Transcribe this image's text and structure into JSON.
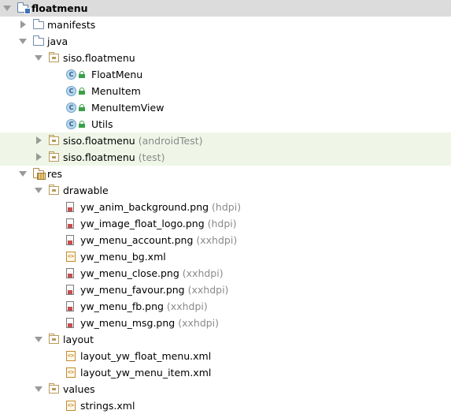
{
  "tree": [
    {
      "id": "floatmenu",
      "label": "floatmenu",
      "hint": "",
      "depth": 0,
      "expanded": true,
      "icon": "module-folder-icon",
      "bold": true,
      "state": "selected"
    },
    {
      "id": "manifests",
      "label": "manifests",
      "hint": "",
      "depth": 1,
      "expanded": false,
      "icon": "folder-icon"
    },
    {
      "id": "java",
      "label": "java",
      "hint": "",
      "depth": 1,
      "expanded": true,
      "icon": "folder-icon"
    },
    {
      "id": "pkg-main",
      "label": "siso.floatmenu",
      "hint": "",
      "depth": 2,
      "expanded": true,
      "icon": "package-icon"
    },
    {
      "id": "FloatMenu",
      "label": "FloatMenu",
      "hint": "",
      "depth": 3,
      "icon": "class-icon"
    },
    {
      "id": "MenuItem",
      "label": "MenuItem",
      "hint": "",
      "depth": 3,
      "icon": "class-icon"
    },
    {
      "id": "MenuItemView",
      "label": "MenuItemView",
      "hint": "",
      "depth": 3,
      "icon": "class-icon"
    },
    {
      "id": "Utils",
      "label": "Utils",
      "hint": "",
      "depth": 3,
      "icon": "class-icon"
    },
    {
      "id": "pkg-androidTest",
      "label": "siso.floatmenu",
      "hint": "(androidTest)",
      "depth": 2,
      "expanded": false,
      "icon": "package-icon",
      "state": "tested"
    },
    {
      "id": "pkg-test",
      "label": "siso.floatmenu",
      "hint": "(test)",
      "depth": 2,
      "expanded": false,
      "icon": "package-icon",
      "state": "tested"
    },
    {
      "id": "res",
      "label": "res",
      "hint": "",
      "depth": 1,
      "expanded": true,
      "icon": "res-folder-icon"
    },
    {
      "id": "drawable",
      "label": "drawable",
      "hint": "",
      "depth": 2,
      "expanded": true,
      "icon": "package-icon"
    },
    {
      "id": "d1",
      "label": "yw_anim_background.png",
      "hint": "(hdpi)",
      "depth": 3,
      "icon": "png-file-icon"
    },
    {
      "id": "d2",
      "label": "yw_image_float_logo.png",
      "hint": "(hdpi)",
      "depth": 3,
      "icon": "png-file-icon"
    },
    {
      "id": "d3",
      "label": "yw_menu_account.png",
      "hint": "(xxhdpi)",
      "depth": 3,
      "icon": "png-file-icon"
    },
    {
      "id": "d4",
      "label": "yw_menu_bg.xml",
      "hint": "",
      "depth": 3,
      "icon": "xml-file-icon"
    },
    {
      "id": "d5",
      "label": "yw_menu_close.png",
      "hint": "(xxhdpi)",
      "depth": 3,
      "icon": "png-file-icon"
    },
    {
      "id": "d6",
      "label": "yw_menu_favour.png",
      "hint": "(xxhdpi)",
      "depth": 3,
      "icon": "png-file-icon"
    },
    {
      "id": "d7",
      "label": "yw_menu_fb.png",
      "hint": "(xxhdpi)",
      "depth": 3,
      "icon": "png-file-icon"
    },
    {
      "id": "d8",
      "label": "yw_menu_msg.png",
      "hint": "(xxhdpi)",
      "depth": 3,
      "icon": "png-file-icon"
    },
    {
      "id": "layout",
      "label": "layout",
      "hint": "",
      "depth": 2,
      "expanded": true,
      "icon": "package-icon"
    },
    {
      "id": "l1",
      "label": "layout_yw_float_menu.xml",
      "hint": "",
      "depth": 3,
      "icon": "xml-file-icon"
    },
    {
      "id": "l2",
      "label": "layout_yw_menu_item.xml",
      "hint": "",
      "depth": 3,
      "icon": "xml-file-icon"
    },
    {
      "id": "values",
      "label": "values",
      "hint": "",
      "depth": 2,
      "expanded": true,
      "icon": "package-icon"
    },
    {
      "id": "v1",
      "label": "strings.xml",
      "hint": "",
      "depth": 3,
      "icon": "xml-file-icon"
    }
  ],
  "colors": {
    "selected": "#dcdcdc",
    "tested": "#eff6e7",
    "hint": "#8a8a8a",
    "accent": "#3c74b8"
  }
}
